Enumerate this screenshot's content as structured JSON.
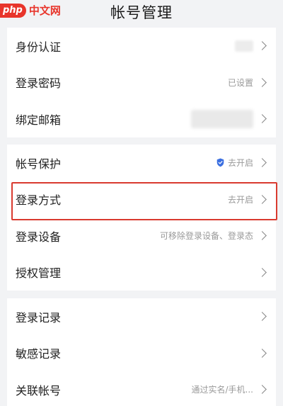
{
  "header": {
    "logo_badge": "php",
    "logo_text": "中文网",
    "title": "帐号管理"
  },
  "groups": [
    {
      "items": [
        {
          "label": "身份认证",
          "value": ""
        },
        {
          "label": "登录密码",
          "value": "已设置"
        },
        {
          "label": "绑定邮箱",
          "value": ""
        }
      ]
    },
    {
      "items": [
        {
          "label": "帐号保护",
          "value": "去开启",
          "icon": "shield-icon"
        },
        {
          "label": "登录方式",
          "value": "去开启",
          "highlighted": true
        },
        {
          "label": "登录设备",
          "value": "可移除登录设备、登录态"
        },
        {
          "label": "授权管理",
          "value": ""
        }
      ]
    },
    {
      "items": [
        {
          "label": "登录记录",
          "value": ""
        },
        {
          "label": "敏感记录",
          "value": ""
        },
        {
          "label": "关联帐号",
          "value": "通过实名/手机..."
        }
      ]
    }
  ],
  "colors": {
    "background": "#f2f3f5",
    "card": "#ffffff",
    "highlight_border": "#d93a2f",
    "shield_blue": "#3b6fe0",
    "logo_red": "#e8352b"
  }
}
